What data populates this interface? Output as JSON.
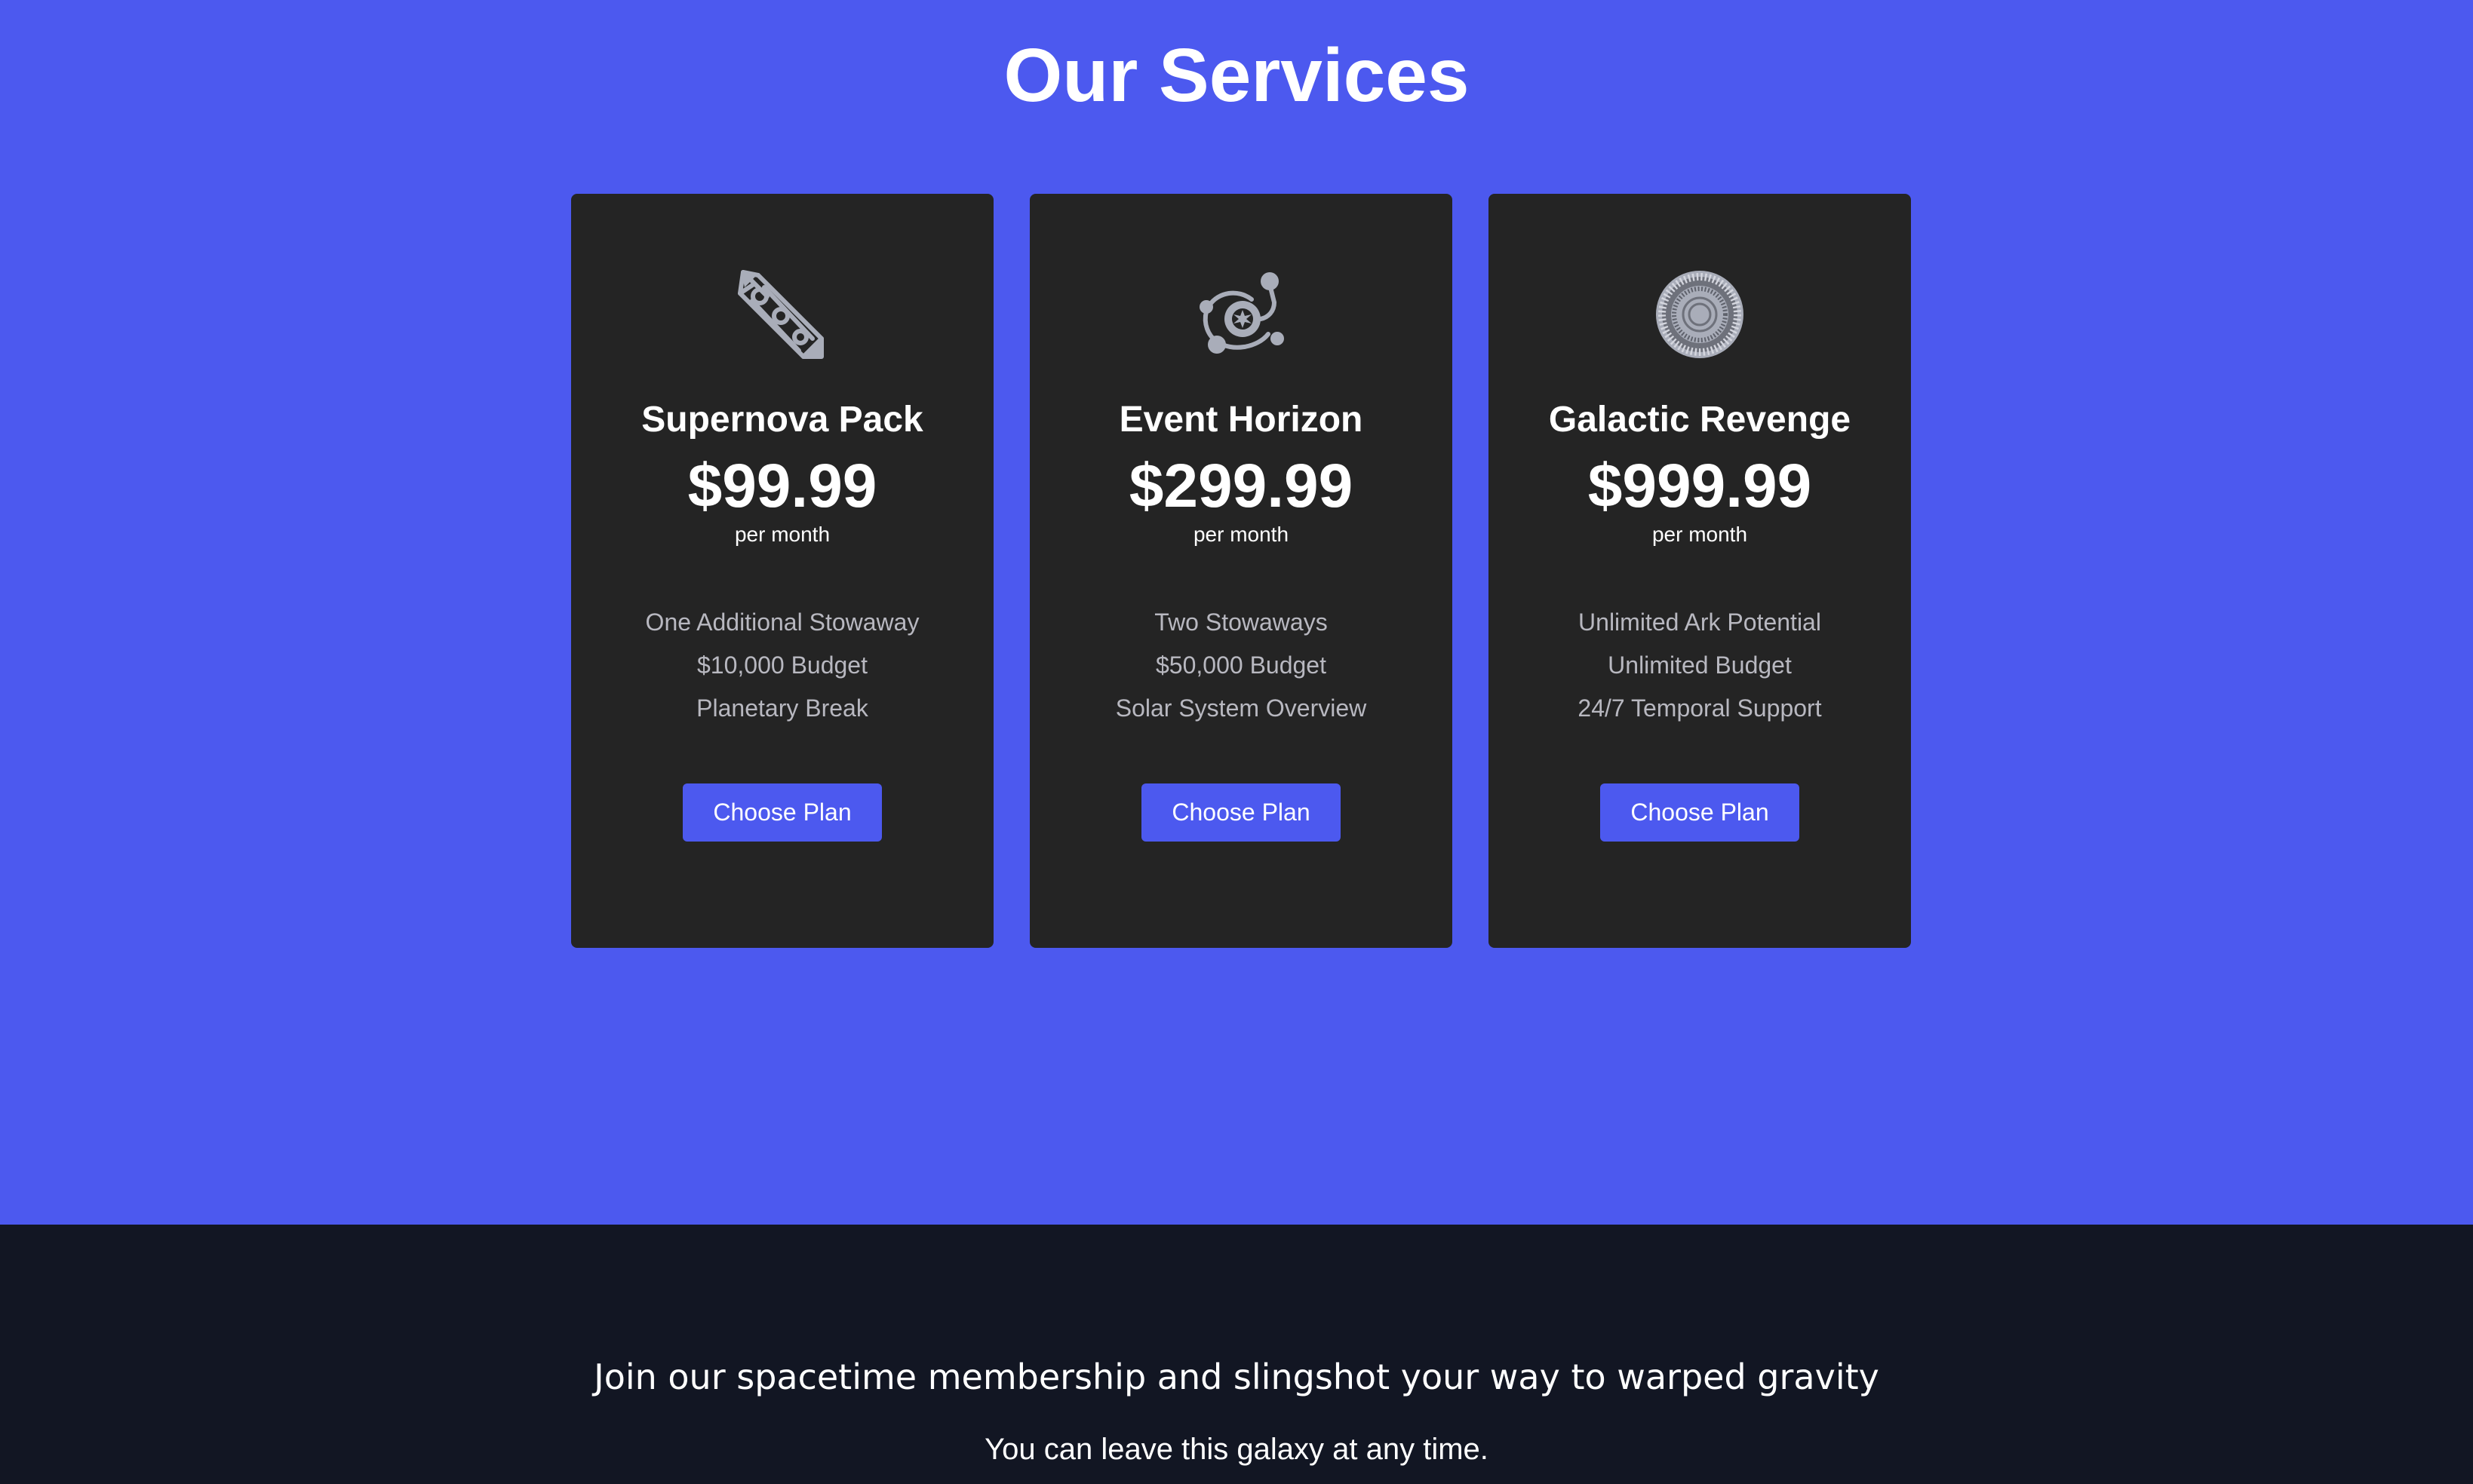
{
  "header": {
    "title": "Our Services"
  },
  "colors": {
    "background": "#4c59ef",
    "card": "#242424",
    "accent": "#4c59ef",
    "icon": "#a9adb9",
    "feature_text": "#b8b8c0",
    "footer_background": "#121623"
  },
  "plans": [
    {
      "icon": "rocket-icon",
      "name": "Supernova Pack",
      "price": "$99.99",
      "period": "per month",
      "features": [
        "One Additional Stowaway",
        "$10,000 Budget",
        "Planetary Break"
      ],
      "button_label": "Choose Plan"
    },
    {
      "icon": "orbit-galaxy-icon",
      "name": "Event Horizon",
      "price": "$299.99",
      "period": "per month",
      "features": [
        "Two Stowaways",
        "$50,000 Budget",
        "Solar System Overview"
      ],
      "button_label": "Choose Plan"
    },
    {
      "icon": "radial-sun-icon",
      "name": "Galactic Revenge",
      "price": "$999.99",
      "period": "per month",
      "features": [
        "Unlimited Ark Potential",
        "Unlimited Budget",
        "24/7 Temporal Support"
      ],
      "button_label": "Choose Plan"
    }
  ],
  "footer": {
    "headline": "Join our spacetime membership and slingshot your way to warped gravity",
    "subtext": "You can leave this galaxy at any time."
  }
}
